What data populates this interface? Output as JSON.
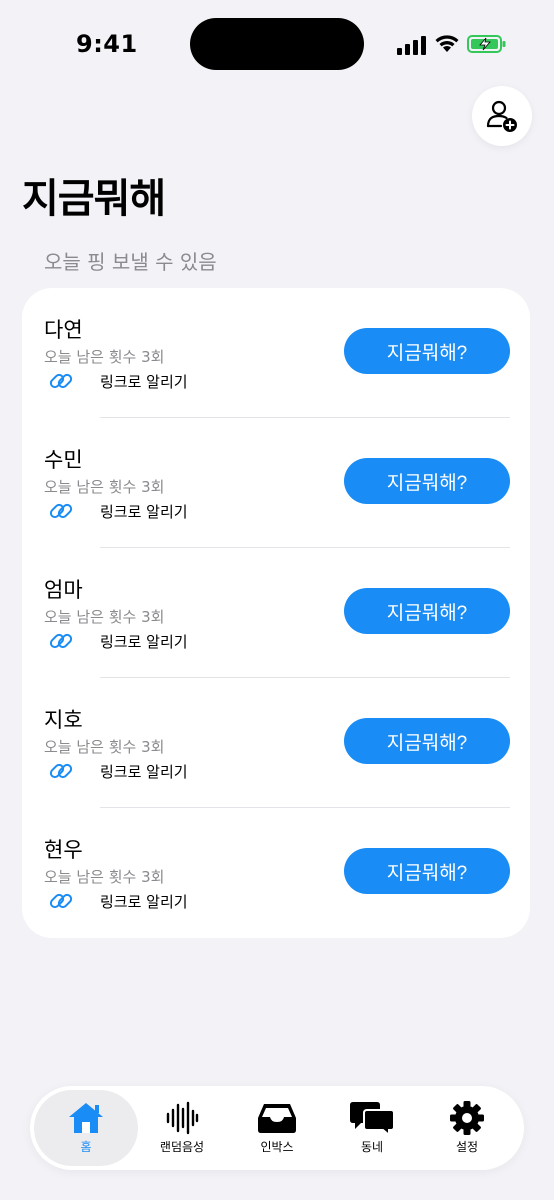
{
  "status": {
    "time": "9:41"
  },
  "header": {
    "title": "지금뭐해",
    "caption": "오늘 핑 보낼 수 있음"
  },
  "friends": [
    {
      "name": "다연",
      "remaining": "오늘 남은 횟수 3회",
      "link_label": "링크로 알리기",
      "action_label": "지금뭐해?"
    },
    {
      "name": "수민",
      "remaining": "오늘 남은 횟수 3회",
      "link_label": "링크로 알리기",
      "action_label": "지금뭐해?"
    },
    {
      "name": "엄마",
      "remaining": "오늘 남은 횟수 3회",
      "link_label": "링크로 알리기",
      "action_label": "지금뭐해?"
    },
    {
      "name": "지호",
      "remaining": "오늘 남은 횟수 3회",
      "link_label": "링크로 알리기",
      "action_label": "지금뭐해?"
    },
    {
      "name": "현우",
      "remaining": "오늘 남은 횟수 3회",
      "link_label": "링크로 알리기",
      "action_label": "지금뭐해?"
    }
  ],
  "tabs": [
    {
      "label": "홈",
      "icon": "home-icon",
      "active": true
    },
    {
      "label": "랜덤음성",
      "icon": "waveform-icon",
      "active": false
    },
    {
      "label": "인박스",
      "icon": "inbox-icon",
      "active": false
    },
    {
      "label": "동네",
      "icon": "chat-bubbles-icon",
      "active": false
    },
    {
      "label": "설정",
      "icon": "gear-icon",
      "active": false
    }
  ],
  "colors": {
    "accent": "#1a8cf5",
    "background": "#f2f2f7",
    "card": "#ffffff",
    "secondary_text": "#8a8a8f",
    "battery": "#34c759"
  }
}
